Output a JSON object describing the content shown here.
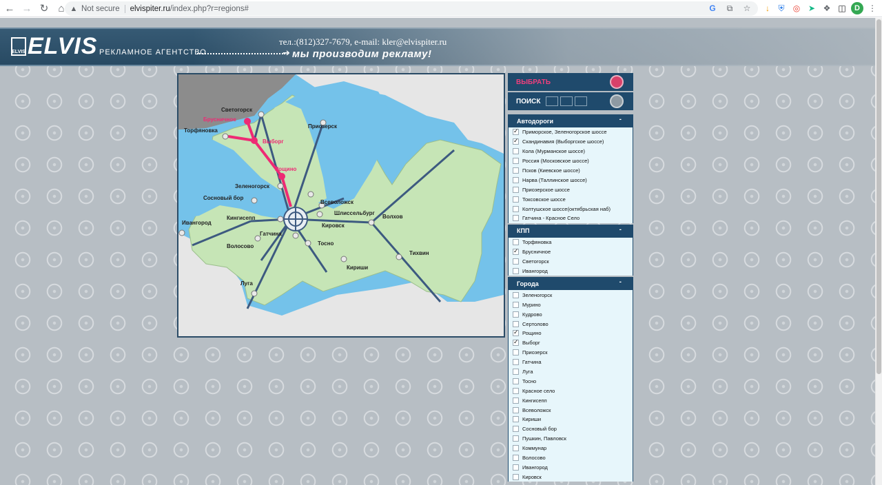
{
  "browser": {
    "not_secure": "Not secure",
    "url_host": "elvispiter.ru",
    "url_path": "/index.php?r=regions#",
    "avatar_letter": "D"
  },
  "header": {
    "logo_small": "ELVIS",
    "logo": "ELVIS",
    "tagline": "РЕКЛАМНОЕ АГЕНТСТВО",
    "slogan": "мы производим рекламу!",
    "contacts": "тел.:(812)327-7679, e-mail: kler@elvispiter.ru"
  },
  "map": {
    "labels": {
      "svetogorsk": "Светогорск",
      "brusnichnoe": "Брусничное",
      "torfyanovka": "Торфяновка",
      "vyborg": "Выборг",
      "priozersk": "Приозерск",
      "roshchino": "Рощино",
      "zelenogorsk": "Зеленогорск",
      "sosnovy_bor": "Сосновый бор",
      "vsevolozhsk": "Всеволожск",
      "shlisselburg": "Шлиссельбург",
      "ivangorod": "Ивангород",
      "kingisepp": "Кингисепп",
      "kirovsk": "Кировск",
      "volkhov": "Волхов",
      "gatchina": "Гатчина",
      "tosno": "Тосно",
      "volosovo": "Волосово",
      "tikhvin": "Тихвин",
      "kirishi": "Кириши",
      "luga": "Луга"
    },
    "colors": {
      "water": "#74c2ea",
      "land": "#c6e5b6",
      "foreign": "#e6e6e6",
      "road": "#3d5a80",
      "selected": "#ee2a74"
    }
  },
  "panel": {
    "select_label": "ВЫБРАТЬ",
    "search_label": "ПОИСК",
    "collapse_symbol": "-",
    "sections": [
      {
        "title": "Автодороги",
        "items": [
          {
            "label": "Приморское, Зеленогорское шоссе",
            "checked": true
          },
          {
            "label": "Скандинавия (Выборгское шоссе)",
            "checked": true
          },
          {
            "label": "Кола (Мурманское шоссе)",
            "checked": false
          },
          {
            "label": "Россия (Московское шоссе)",
            "checked": false
          },
          {
            "label": "Псков (Киевское шоссе)",
            "checked": false
          },
          {
            "label": "Нарва (Таллинское шоссе)",
            "checked": false
          },
          {
            "label": "Приозерское шоссе",
            "checked": false
          },
          {
            "label": "Токсовское шоссе",
            "checked": false
          },
          {
            "label": "Колтушское шоссе(октябрьская наб)",
            "checked": false
          },
          {
            "label": "Гатчина - Красное Село",
            "checked": false
          }
        ]
      },
      {
        "title": "КПП",
        "items": [
          {
            "label": "Торфяновка",
            "checked": false
          },
          {
            "label": "Брусничное",
            "checked": true
          },
          {
            "label": "Светогорск",
            "checked": false
          },
          {
            "label": "Ивангород",
            "checked": false
          }
        ]
      },
      {
        "title": "Города",
        "items": [
          {
            "label": "Зеленогорск",
            "checked": false
          },
          {
            "label": "Мурино",
            "checked": false
          },
          {
            "label": "Кудрово",
            "checked": false
          },
          {
            "label": "Сертолово",
            "checked": false
          },
          {
            "label": "Рощино",
            "checked": true
          },
          {
            "label": "Выборг",
            "checked": true
          },
          {
            "label": "Приозерск",
            "checked": false
          },
          {
            "label": "Гатчина",
            "checked": false
          },
          {
            "label": "Луга",
            "checked": false
          },
          {
            "label": "Тосно",
            "checked": false
          },
          {
            "label": "Красное село",
            "checked": false
          },
          {
            "label": "Кингисепп",
            "checked": false
          },
          {
            "label": "Всеволожск",
            "checked": false
          },
          {
            "label": "Кириши",
            "checked": false
          },
          {
            "label": "Сосновый бор",
            "checked": false
          },
          {
            "label": "Пушкин, Павловск",
            "checked": false
          },
          {
            "label": "Коммунар",
            "checked": false
          },
          {
            "label": "Волосово",
            "checked": false
          },
          {
            "label": "Ивангород",
            "checked": false
          },
          {
            "label": "Кировск",
            "checked": false
          }
        ]
      }
    ]
  }
}
